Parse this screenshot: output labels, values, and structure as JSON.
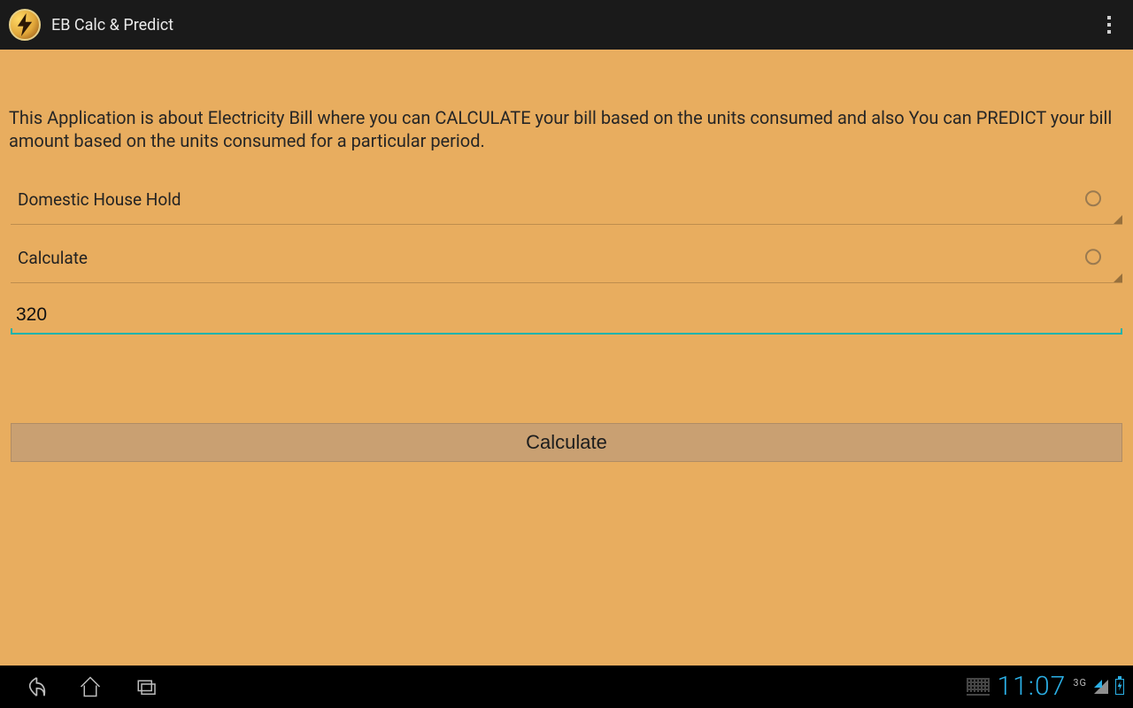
{
  "header": {
    "app_title": "EB Calc & Predict"
  },
  "main": {
    "description": "This Application is about Electricity Bill where you can CALCULATE your bill based on the units consumed and also You can PREDICT your bill amount based on the units consumed for a particular period.",
    "spinner_category": {
      "selected": "Domestic House Hold"
    },
    "spinner_mode": {
      "selected": "Calculate"
    },
    "units_input": {
      "value": "320"
    },
    "calculate_button_label": "Calculate"
  },
  "statusbar": {
    "time": "11:07",
    "network_label": "3G"
  },
  "colors": {
    "background": "#e8ad5f",
    "accent_underline": "#17b3ac",
    "button_bg": "#c9a072",
    "clock": "#2bb0e6",
    "actionbar_bg": "#1a1a1a"
  }
}
